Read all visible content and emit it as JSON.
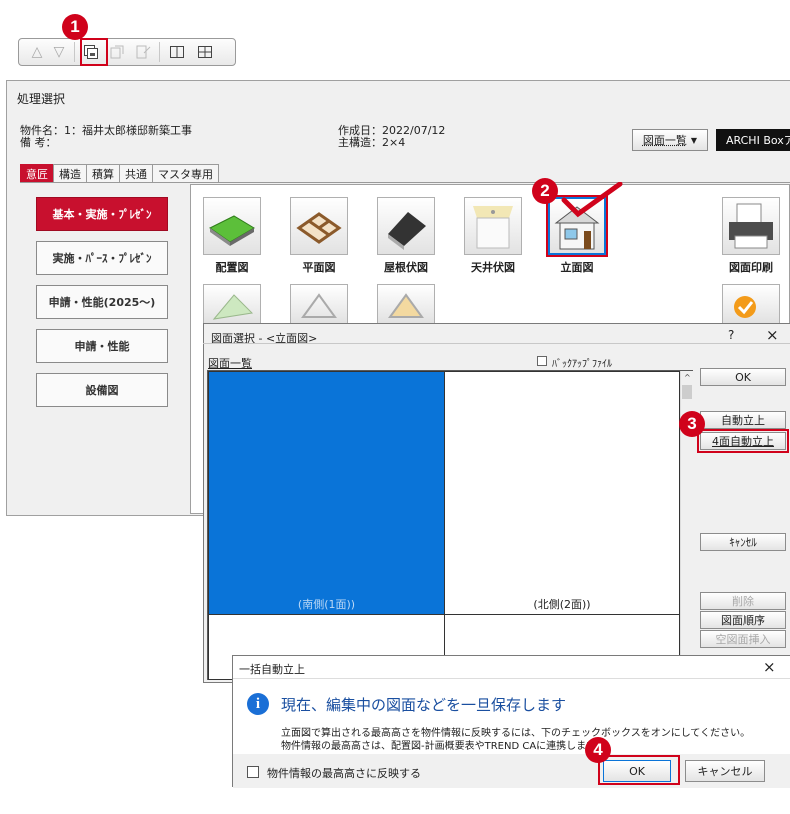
{
  "markers": {
    "m1": "1",
    "m2": "2",
    "m3": "3",
    "m4": "4"
  },
  "main": {
    "title": "処理選択",
    "property_name": "物件名：1：福井太郎様邸新築工事",
    "remarks": "備 考：",
    "created": "作成日：2022/07/12",
    "structure": "主構造：2×4",
    "drawing_list_btn": "図面一覧",
    "archi_box": "ARCHI Boxア"
  },
  "tabs": [
    "意匠",
    "構造",
    "積算",
    "共通",
    "マスタ専用"
  ],
  "side_buttons": [
    "基本・実施・ﾌﾟﾚｾﾞﾝ",
    "実施・ﾊﾟｰｽ・ﾌﾟﾚｾﾞﾝ",
    "申請・性能(2025〜)",
    "申請・性能",
    "設備図"
  ],
  "drawing_icons": [
    "配置図",
    "平面図",
    "屋根伏図",
    "天井伏図",
    "立面図",
    "図面印刷"
  ],
  "dialog": {
    "title": "図面選択 - <立面図>",
    "help": "?",
    "close": "×",
    "list_label": "図面一覧",
    "backup_label": "ﾊﾞｯｸｱｯﾌﾟﾌｧｲﾙ",
    "cell_south": "(南側(1面))",
    "cell_north": "(北側(2面))",
    "ok": "OK",
    "auto": "自動立上",
    "auto4": "4面自動立上",
    "cancel": "ｷｬﾝｾﾙ",
    "delete": "削除",
    "order": "図面順序",
    "insert": "空図面挿入"
  },
  "dialog2": {
    "title": "一括自動立上",
    "close": "×",
    "heading": "現在、編集中の図面などを一旦保存します",
    "line1": "立面図で算出される最高高さを物件情報に反映するには、下のチェックボックスをオンにしてください。",
    "line2": "物件情報の最高高さは、配置図-計画概要表やTREND CAに連携します。",
    "checkbox_label": "物件情報の最高高さに反映する",
    "ok": "OK",
    "cancel": "キャンセル"
  },
  "colors": {
    "accent": "#c8102e",
    "selected": "#0a74d8",
    "info": "#1a6fd6"
  }
}
